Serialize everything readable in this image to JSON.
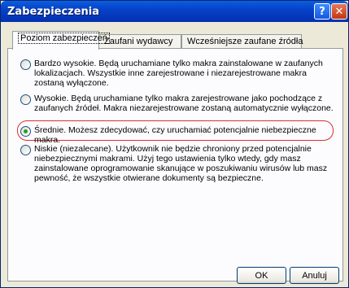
{
  "window": {
    "title": "Zabezpieczenia",
    "help_label": "?",
    "close_label": "✕"
  },
  "tabs": [
    {
      "label": "Poziom zabezpieczeń",
      "active": true
    },
    {
      "label": "Zaufani wydawcy",
      "active": false
    },
    {
      "label": "Wcześniejsze zaufane źródła",
      "active": false
    }
  ],
  "options": [
    {
      "label": "Bardzo wysokie. Będą uruchamiane tylko makra zainstalowane w zaufanych lokalizacjach. Wszystkie inne zarejestrowane i niezarejestrowane makra zostaną wyłączone.",
      "checked": false
    },
    {
      "label": "Wysokie. Będą uruchamiane tylko makra zarejestrowane jako pochodzące z zaufanych źródeł. Makra niezarejestrowane zostaną automatycznie wyłączone.",
      "checked": false
    },
    {
      "label": "Średnie. Możesz zdecydować, czy uruchamiać potencjalnie niebezpieczne makra.",
      "checked": true
    },
    {
      "label": "Niskie (niezalecane). Użytkownik nie będzie chroniony przed potencjalnie niebezpiecznymi makrami. Użyj tego ustawienia tylko wtedy, gdy masz zainstalowane oprogramowanie skanujące w poszukiwaniu wirusów lub masz pewność, że wszystkie otwierane dokumenty są bezpieczne.",
      "checked": false
    }
  ],
  "buttons": {
    "ok": "OK",
    "cancel": "Anuluj"
  },
  "colors": {
    "titlebar": "#0641c8",
    "highlight": "#d93030",
    "radio_checked": "#21a121"
  }
}
